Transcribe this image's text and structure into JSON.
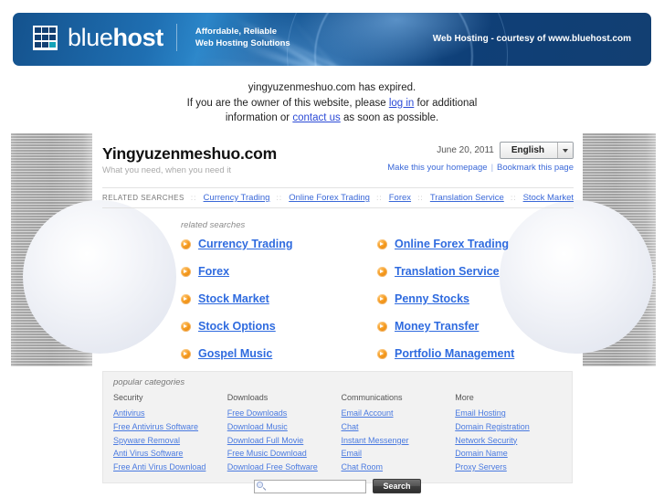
{
  "banner": {
    "logo_text_light": "blue",
    "logo_text_bold": "host",
    "tagline_line1": "Affordable, Reliable",
    "tagline_line2": "Web Hosting Solutions",
    "right_text": "Web Hosting - courtesy of www.bluehost.com",
    "accent_color": "#12a3b8",
    "background_color": "#123f72"
  },
  "notice": {
    "line1": "yingyuzenmeshuo.com has expired.",
    "line2_pre": "If you are the owner of this website, please ",
    "login_label": "log in",
    "line2_post": " for additional",
    "line3_pre": "information or ",
    "contact_label": "contact us",
    "line3_post": " as soon as possible."
  },
  "header": {
    "site_title": "Yingyuzenmeshuo.com",
    "tagline": "What you need, when you need it",
    "date": "June 20, 2011",
    "language_selected": "English",
    "homepage_link": "Make this your homepage",
    "bookmark_link": "Bookmark this page",
    "separator": "|"
  },
  "related_bar": {
    "label": "RELATED SEARCHES",
    "separator": "::",
    "items": [
      "Currency Trading",
      "Online Forex Trading",
      "Forex",
      "Translation Service",
      "Stock Market"
    ]
  },
  "related_searches": {
    "caption": "related searches",
    "items": [
      "Currency Trading",
      "Online Forex Trading",
      "Forex",
      "Translation Service",
      "Stock Market",
      "Penny Stocks",
      "Stock Options",
      "Money Transfer",
      "Gospel Music",
      "Portfolio Management"
    ]
  },
  "popular_categories": {
    "caption": "popular categories",
    "columns": [
      {
        "heading": "Security",
        "links": [
          "Antivirus",
          "Free Antivirus Software",
          "Spyware Removal",
          "Anti Virus Software",
          "Free Anti Virus Download"
        ]
      },
      {
        "heading": "Downloads",
        "links": [
          "Free Downloads",
          "Download Music",
          "Download Full Movie",
          "Free Music Download",
          "Download Free Software"
        ]
      },
      {
        "heading": "Communications",
        "links": [
          "Email Account",
          "Chat",
          "Instant Messenger",
          "Email",
          "Chat Room"
        ]
      },
      {
        "heading": "More",
        "links": [
          "Email Hosting",
          "Domain Registration",
          "Network Security",
          "Domain Name",
          "Proxy Servers"
        ]
      }
    ]
  },
  "search": {
    "value": "",
    "placeholder": "",
    "button_label": "Search"
  }
}
